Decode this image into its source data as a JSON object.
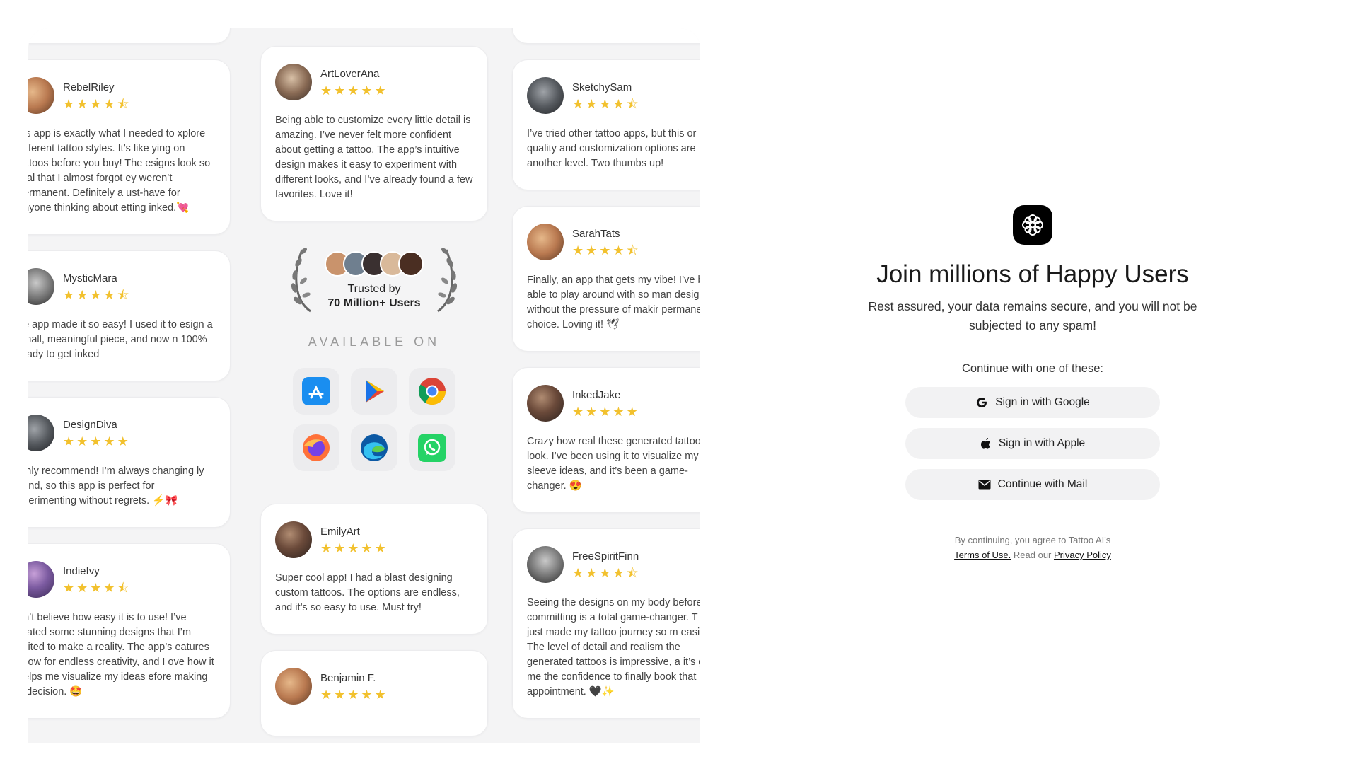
{
  "reviews": {
    "col1": [
      {
        "name": "RebelRiley",
        "stars": 4.5,
        "text": "his app is exactly what I needed to xplore different tattoo styles. It’s like ying on tattoos before you buy! The esigns look so real that I almost forgot ey weren’t permanent. Definitely a ust-have for anyone thinking about etting inked.💘"
      },
      {
        "name": "MysticMara",
        "stars": 4.5,
        "text": "he app made it so easy! I used it to esign a small, meaningful piece, and now n 100% ready to get inked"
      },
      {
        "name": "DesignDiva",
        "stars": 5,
        "text": "ighly recommend! I’m always changing ly mind, so this app is perfect for xperimenting without regrets. ⚡🎀"
      },
      {
        "name": "IndieIvy",
        "stars": 4.5,
        "text": "an’t believe how easy it is to use! I’ve reated some stunning designs that I’m xcited to make a reality. The app’s eatures allow for endless creativity, and I ove how it helps me visualize my ideas efore making a decision. 🤩"
      }
    ],
    "col2": [
      {
        "name": "ArtLoverAna",
        "stars": 5,
        "text": "Being able to customize every little detail is amazing. I’ve never felt more confident about getting a tattoo. The app’s intuitive design makes it easy to experiment with different looks, and I’ve already found a few favorites. Love it!"
      },
      {
        "name": "EmilyArt",
        "stars": 5,
        "text": "Super cool app! I had a blast designing custom tattoos. The options are endless, and it’s so easy to use. Must try!"
      },
      {
        "name": "Benjamin F.",
        "stars": 5,
        "text": ""
      }
    ],
    "col3": [
      {
        "name": "SketchySam",
        "stars": 4.5,
        "text": "I’ve tried other tattoo apps, but this or quality and customization options are another level. Two thumbs up!"
      },
      {
        "name": "SarahTats",
        "stars": 4.5,
        "text": "Finally, an app that gets my vibe! I’ve been able to play around with so man designs without the pressure of makir permanent choice. Loving it! 🕊"
      },
      {
        "name": "InkedJake",
        "stars": 5,
        "text": "Crazy how real these generated tattoo look. I’ve been using it to visualize my sleeve ideas, and it’s been a game-changer. 😍"
      },
      {
        "name": "FreeSpiritFinn",
        "stars": 4.5,
        "text": "Seeing the designs on my body before committing is a total game-changer. T app just made my tattoo journey so m easier. The level of detail and realism the generated tattoos is impressive, a it’s given me the confidence to finally book that appointment. 🖤✨"
      }
    ]
  },
  "trust": {
    "line1": "Trusted by",
    "line2": "70 Million+ Users",
    "available": "AVAILABLE ON",
    "stores": [
      "app-store-icon",
      "google-play-icon",
      "chrome-icon",
      "firefox-icon",
      "edge-icon",
      "whatsapp-icon"
    ]
  },
  "signin": {
    "headline": "Join millions of Happy Users",
    "subtext": "Rest assured, your data remains secure, and you will not be subjected to any spam!",
    "continue_label": "Continue with one of these:",
    "google": "Sign in with Google",
    "apple": "Sign in with Apple",
    "mail": "Continue with Mail",
    "legal_prefix": "By continuing, you agree to Tattoo AI's",
    "terms": "Terms of Use.",
    "legal_mid": " Read our ",
    "privacy": "Privacy Policy"
  },
  "colors": {
    "star": "#f2c12e",
    "button_bg": "#f2f2f3",
    "logo_bg": "#000000"
  }
}
